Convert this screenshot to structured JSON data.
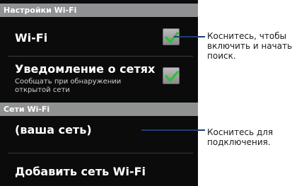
{
  "sections": {
    "wifi_settings": "Настройки Wi-Fi",
    "wifi_networks": "Сети Wi-Fi"
  },
  "rows": {
    "wifi": {
      "title": "Wi-Fi",
      "checked": true
    },
    "notifications": {
      "title": "Уведомление о сетях",
      "subtitle": "Сообщать при обнаружении открытой сети",
      "checked": true
    },
    "your_network": {
      "title": "(ваша сеть)"
    },
    "add_network": {
      "title": "Добавить сеть Wi-Fi"
    }
  },
  "callouts": {
    "checkbox_hint": "Коснитесь, чтобы\nвключить и начать\nпоиск.",
    "network_hint": "Коснитесь для\nподключения."
  },
  "colors": {
    "check": "#2fbf3a",
    "header_bg": "#8f9193",
    "callout_line": "#1f3d72"
  }
}
